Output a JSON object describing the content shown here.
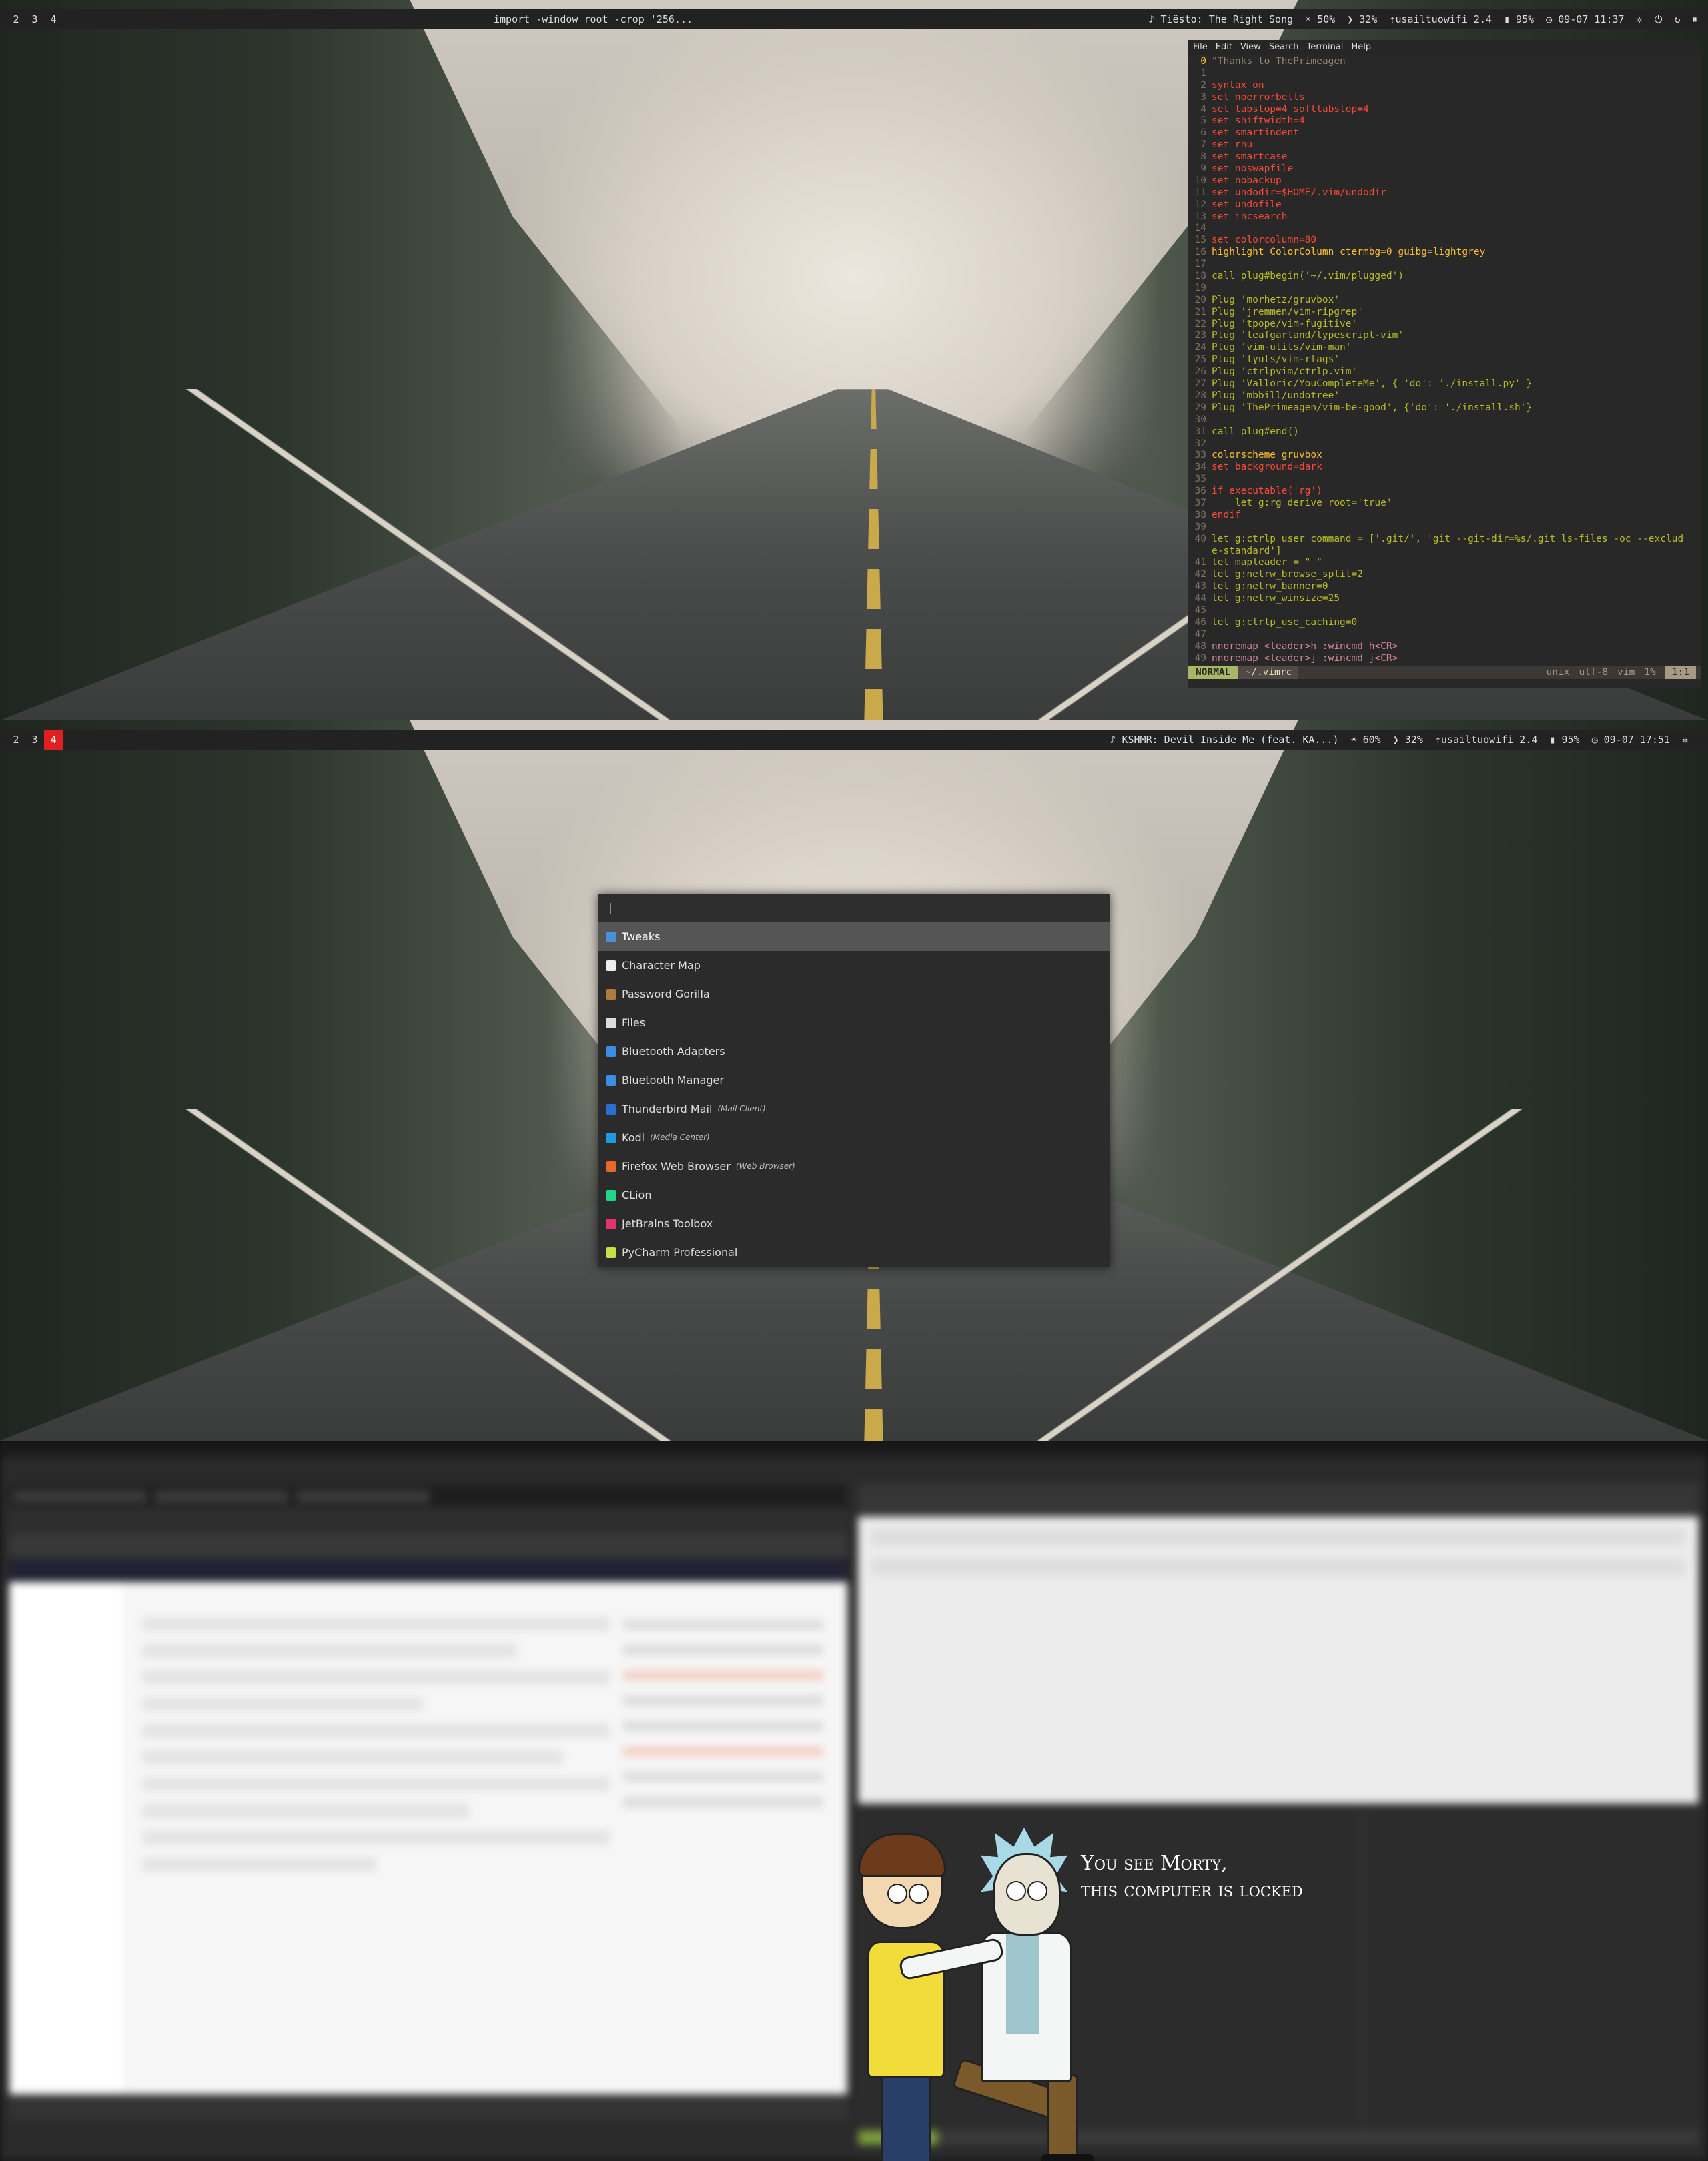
{
  "panel1": {
    "bar": {
      "workspaces": [
        "2",
        "3",
        "4"
      ],
      "active_index": -1,
      "window_title": "import -window root -crop '256...",
      "music": "♪ Tiësto: The Right Song",
      "brightness": "☀ 50%",
      "volume": "❯ 32%",
      "wifi": "usailtuowifi 2.4",
      "battery": "▮ 95%",
      "clock": "◷ 09-07 11:37",
      "icons": [
        "settings-icon",
        "power-icon",
        "refresh-icon",
        "pause-icon"
      ]
    },
    "vim": {
      "menu": [
        "File",
        "Edit",
        "View",
        "Search",
        "Terminal",
        "Help"
      ],
      "lines": [
        {
          "n": "0",
          "t": "\"Thanks to ThePrimeagen",
          "c": "cm"
        },
        {
          "n": "1",
          "t": "",
          "c": ""
        },
        {
          "n": "2",
          "t": "syntax on",
          "c": "kw"
        },
        {
          "n": "3",
          "t": "set noerrorbells",
          "c": "kw"
        },
        {
          "n": "4",
          "t": "set tabstop=4 softtabstop=4",
          "c": "kw"
        },
        {
          "n": "5",
          "t": "set shiftwidth=4",
          "c": "kw"
        },
        {
          "n": "6",
          "t": "set smartindent",
          "c": "kw"
        },
        {
          "n": "7",
          "t": "set rnu",
          "c": "kw"
        },
        {
          "n": "8",
          "t": "set smartcase",
          "c": "kw"
        },
        {
          "n": "9",
          "t": "set noswapfile",
          "c": "kw"
        },
        {
          "n": "10",
          "t": "set nobackup",
          "c": "kw"
        },
        {
          "n": "11",
          "t": "set undodir=$HOME/.vim/undodir",
          "c": "kw"
        },
        {
          "n": "12",
          "t": "set undofile",
          "c": "kw"
        },
        {
          "n": "13",
          "t": "set incsearch",
          "c": "kw"
        },
        {
          "n": "14",
          "t": "",
          "c": ""
        },
        {
          "n": "15",
          "t": "set colorcolumn=80",
          "c": "kw"
        },
        {
          "n": "16",
          "t": "highlight ColorColumn ctermbg=0 guibg=lightgrey",
          "c": "fn"
        },
        {
          "n": "17",
          "t": "",
          "c": ""
        },
        {
          "n": "18",
          "t": "call plug#begin('~/.vim/plugged')",
          "c": "st"
        },
        {
          "n": "19",
          "t": "",
          "c": ""
        },
        {
          "n": "20",
          "t": "Plug 'morhetz/gruvbox'",
          "c": "st"
        },
        {
          "n": "21",
          "t": "Plug 'jremmen/vim-ripgrep'",
          "c": "st"
        },
        {
          "n": "22",
          "t": "Plug 'tpope/vim-fugitive'",
          "c": "st"
        },
        {
          "n": "23",
          "t": "Plug 'leafgarland/typescript-vim'",
          "c": "st"
        },
        {
          "n": "24",
          "t": "Plug 'vim-utils/vim-man'",
          "c": "st"
        },
        {
          "n": "25",
          "t": "Plug 'lyuts/vim-rtags'",
          "c": "st"
        },
        {
          "n": "26",
          "t": "Plug 'ctrlpvim/ctrlp.vim'",
          "c": "st"
        },
        {
          "n": "27",
          "t": "Plug 'Valloric/YouCompleteMe', { 'do': './install.py' }",
          "c": "st"
        },
        {
          "n": "28",
          "t": "Plug 'mbbill/undotree'",
          "c": "st"
        },
        {
          "n": "29",
          "t": "Plug 'ThePrimeagen/vim-be-good', {'do': './install.sh'}",
          "c": "st"
        },
        {
          "n": "30",
          "t": "",
          "c": ""
        },
        {
          "n": "31",
          "t": "call plug#end()",
          "c": "st"
        },
        {
          "n": "32",
          "t": "",
          "c": ""
        },
        {
          "n": "33",
          "t": "colorscheme gruvbox",
          "c": "fn"
        },
        {
          "n": "34",
          "t": "set background=dark",
          "c": "kw"
        },
        {
          "n": "35",
          "t": "",
          "c": ""
        },
        {
          "n": "36",
          "t": "if executable('rg')",
          "c": "kw"
        },
        {
          "n": "37",
          "t": "    let g:rg_derive_root='true'",
          "c": "st"
        },
        {
          "n": "38",
          "t": "endif",
          "c": "kw"
        },
        {
          "n": "39",
          "t": "",
          "c": ""
        },
        {
          "n": "40",
          "t": "let g:ctrlp_user_command = ['.git/', 'git --git-dir=%s/.git ls-files -oc --exclud",
          "c": "st"
        },
        {
          "n": "",
          "t": "e-standard']",
          "c": "st"
        },
        {
          "n": "41",
          "t": "let mapleader = \" \"",
          "c": "st"
        },
        {
          "n": "42",
          "t": "let g:netrw_browse_split=2",
          "c": "st"
        },
        {
          "n": "43",
          "t": "let g:netrw_banner=0",
          "c": "st"
        },
        {
          "n": "44",
          "t": "let g:netrw_winsize=25",
          "c": "st"
        },
        {
          "n": "45",
          "t": "",
          "c": ""
        },
        {
          "n": "46",
          "t": "let g:ctrlp_use_caching=0",
          "c": "st"
        },
        {
          "n": "47",
          "t": "",
          "c": ""
        },
        {
          "n": "48",
          "t": "nnoremap <leader>h :wincmd h<CR>",
          "c": "nm"
        },
        {
          "n": "49",
          "t": "nnoremap <leader>j :wincmd j<CR>",
          "c": "nm"
        }
      ],
      "status": {
        "mode": "NORMAL",
        "file": "~/.vimrc",
        "format": "unix",
        "encoding": "utf-8",
        "filetype": "vim",
        "percent": "1%",
        "position": "1:1"
      }
    }
  },
  "panel2": {
    "bar": {
      "workspaces": [
        "2",
        "3",
        "4"
      ],
      "active_index": 2,
      "music": "♪ KSHMR: Devil Inside Me (feat. KA...)",
      "brightness": "☀ 60%",
      "volume": "❯ 32%",
      "wifi": "usailtuowifi 2.4",
      "battery": "▮ 95%",
      "clock": "◷ 09-07 17:51",
      "icons": [
        "settings-icon"
      ]
    },
    "launcher": {
      "query": "|",
      "items": [
        {
          "label": "Tweaks",
          "sub": "",
          "color": "#4a90d9",
          "icon": "tweaks-icon"
        },
        {
          "label": "Character Map",
          "sub": "",
          "color": "#eeeeee",
          "icon": "character-map-icon"
        },
        {
          "label": "Password Gorilla",
          "sub": "",
          "color": "#b07a40",
          "icon": "password-gorilla-icon"
        },
        {
          "label": "Files",
          "sub": "",
          "color": "#dddddd",
          "icon": "files-icon"
        },
        {
          "label": "Bluetooth Adapters",
          "sub": "",
          "color": "#3a8ee6",
          "icon": "bluetooth-icon"
        },
        {
          "label": "Bluetooth Manager",
          "sub": "",
          "color": "#3a8ee6",
          "icon": "bluetooth-icon"
        },
        {
          "label": "Thunderbird Mail",
          "sub": "(Mail Client)",
          "color": "#2a6fd0",
          "icon": "thunderbird-icon"
        },
        {
          "label": "Kodi",
          "sub": "(Media Center)",
          "color": "#1e9be0",
          "icon": "kodi-icon"
        },
        {
          "label": "Firefox Web Browser",
          "sub": "(Web Browser)",
          "color": "#e66a2c",
          "icon": "firefox-icon"
        },
        {
          "label": "CLion",
          "sub": "",
          "color": "#21d789",
          "icon": "clion-icon"
        },
        {
          "label": "JetBrains Toolbox",
          "sub": "",
          "color": "#e0346c",
          "icon": "jetbrains-toolbox-icon"
        },
        {
          "label": "PyCharm Professional",
          "sub": "",
          "color": "#c6e04a",
          "icon": "pycharm-icon"
        }
      ],
      "selected_index": 0
    }
  },
  "panel3": {
    "lock_message": [
      "You see Morty,",
      "this computer is locked"
    ]
  }
}
